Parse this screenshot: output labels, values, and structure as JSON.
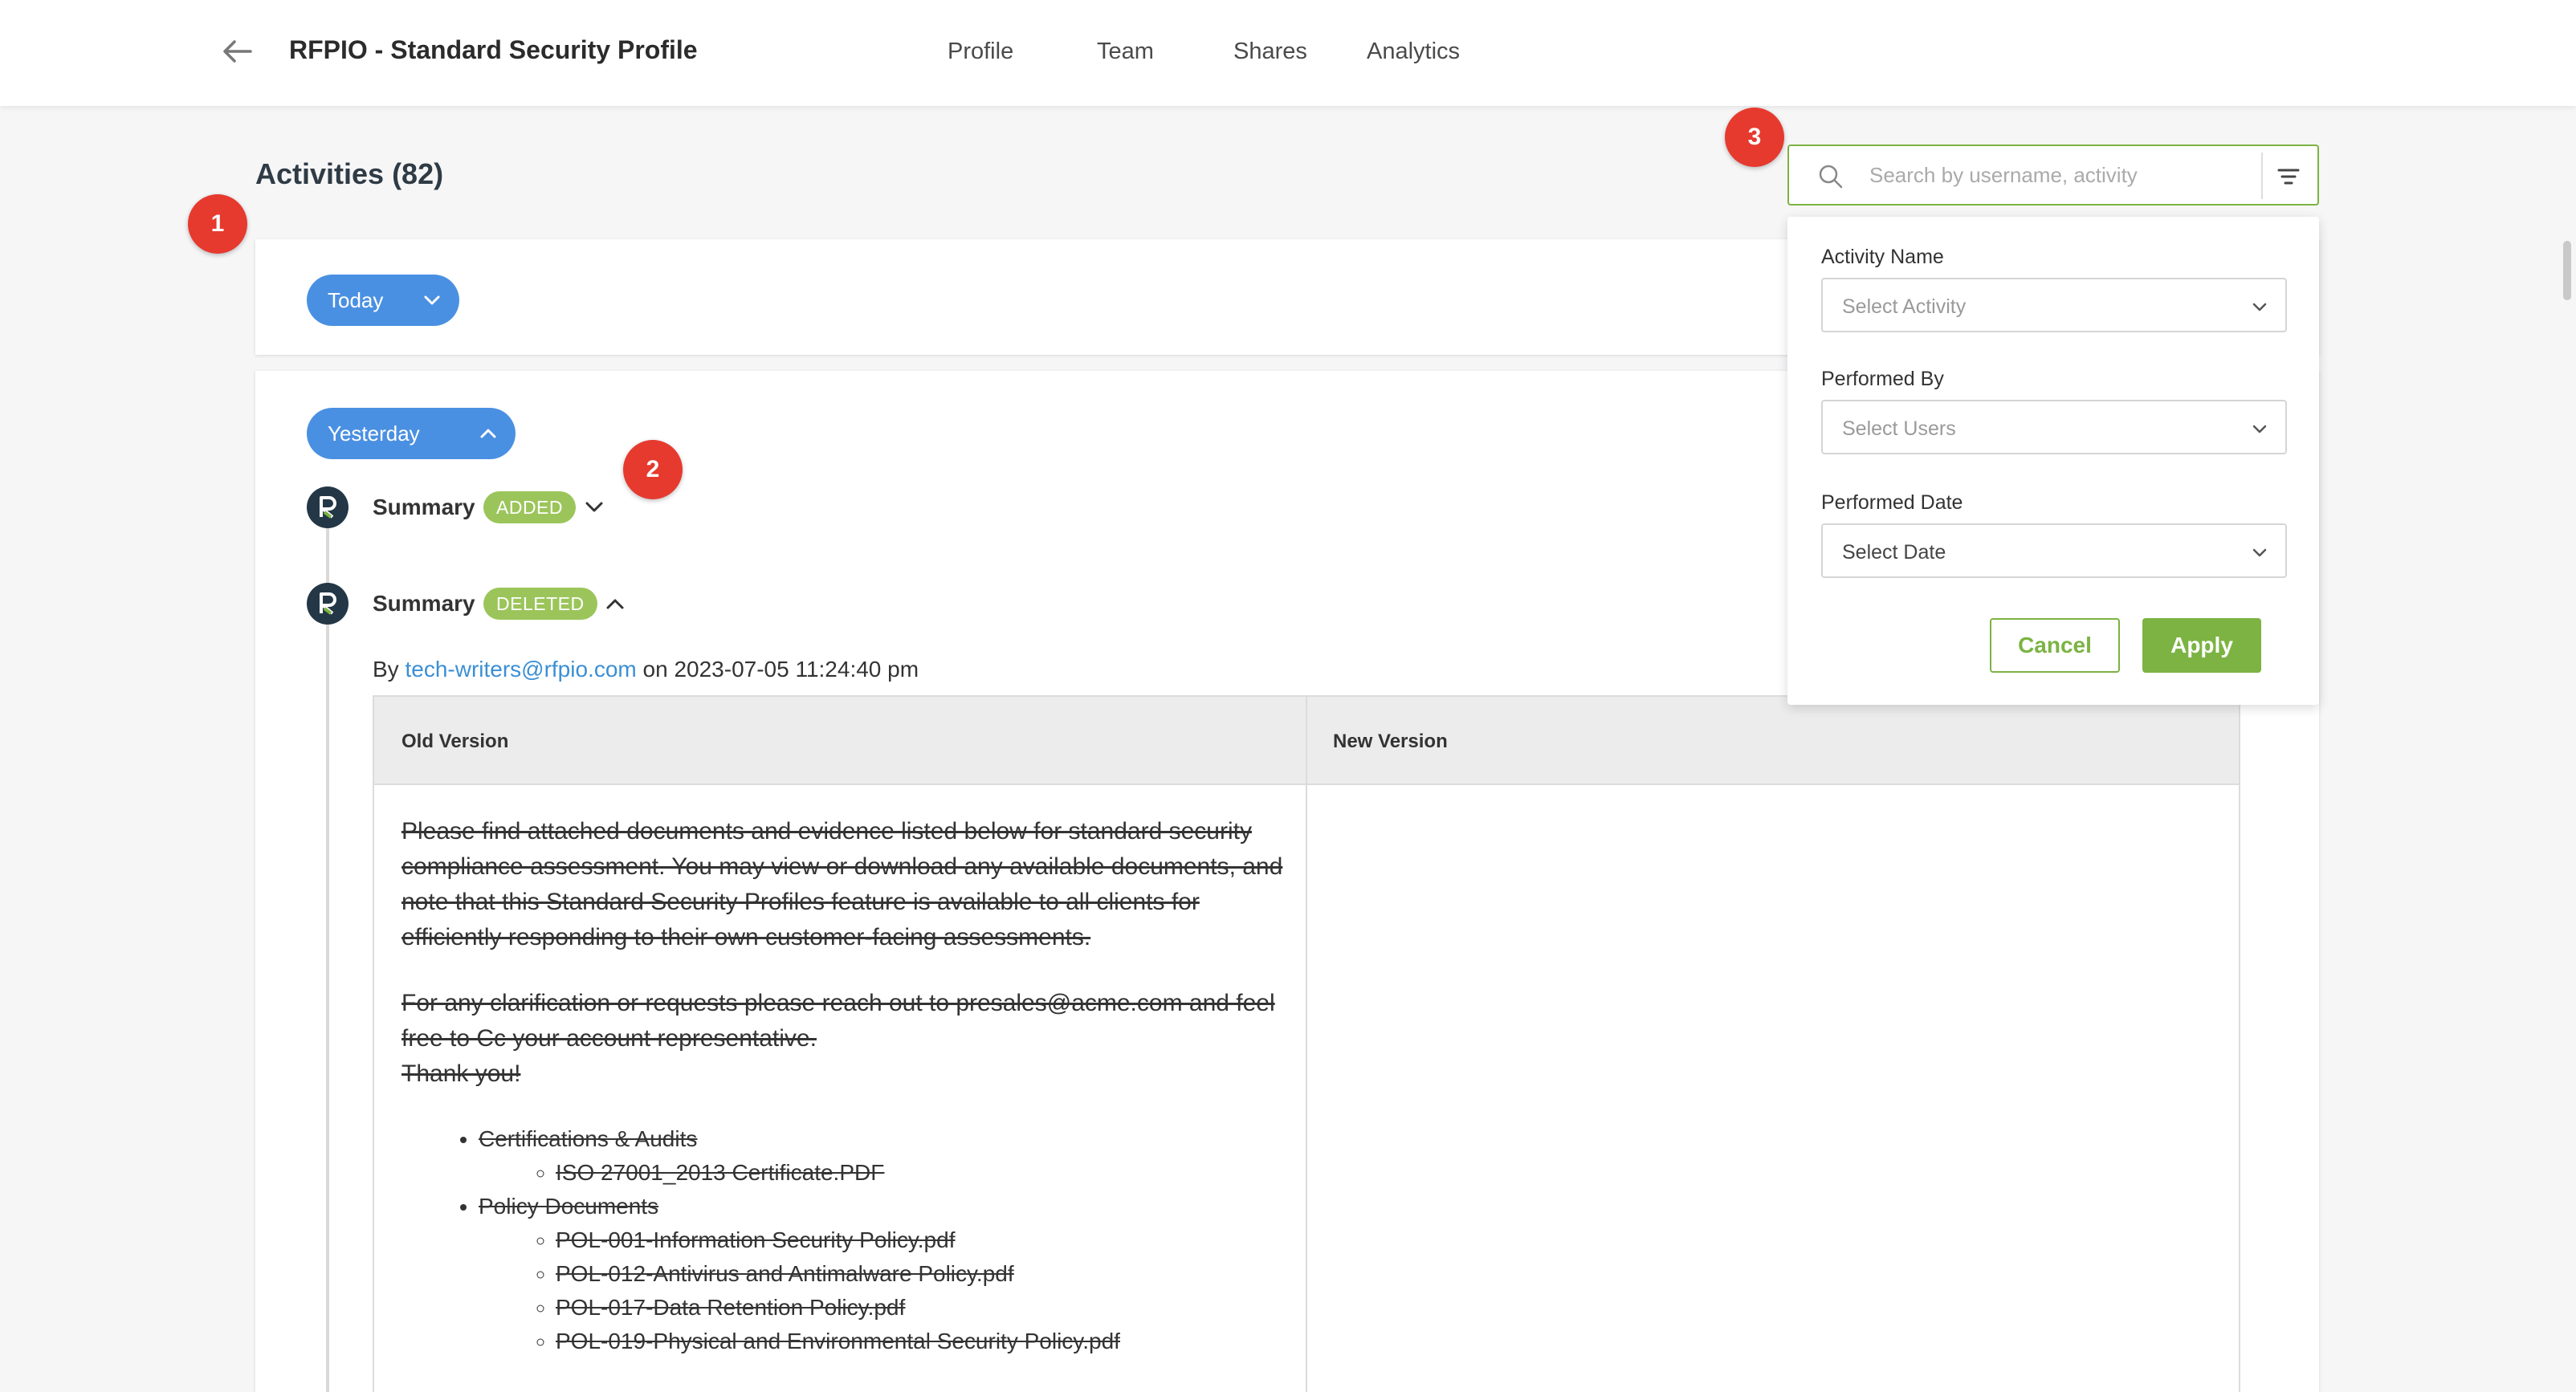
{
  "header": {
    "title": "RFPIO - Standard Security Profile",
    "tabs": [
      {
        "label": "Profile"
      },
      {
        "label": "Team"
      },
      {
        "label": "Shares"
      },
      {
        "label": "Analytics"
      }
    ]
  },
  "activities": {
    "title": "Activities (82)"
  },
  "markers": [
    "1",
    "2",
    "3"
  ],
  "groups": {
    "today": {
      "label": "Today"
    },
    "yesterday": {
      "label": "Yesterday"
    }
  },
  "entries": [
    {
      "label": "Summary",
      "status": "ADDED"
    },
    {
      "label": "Summary",
      "status": "DELETED"
    }
  ],
  "detail": {
    "by_prefix": "By",
    "user": "tech-writers@rfpio.com",
    "on_prefix": "on",
    "timestamp": "2023-07-05 11:24:40 pm",
    "old_header": "Old Version",
    "new_header": "New Version",
    "paragraph1": "Please find attached documents and evidence listed below for standard security compliance assessment. You may view or download any available documents, and note that this Standard Security Profiles feature is available to all clients for efficiently responding to their own customer-facing assessments.",
    "paragraph2": "For any clarification or requests please reach out to presales@acme.com and feel free to Cc your account representative.",
    "paragraph3": "Thank you!",
    "list": [
      {
        "title": "Certifications & Audits",
        "items": [
          "ISO 27001_2013 Certificate.PDF"
        ]
      },
      {
        "title": "Policy Documents",
        "items": [
          "POL-001-Information Security Policy.pdf",
          "POL-012-Antivirus and Antimalware Policy.pdf",
          "POL-017-Data Retention Policy.pdf",
          "POL-019-Physical and Environmental Security Policy.pdf"
        ]
      }
    ]
  },
  "search": {
    "placeholder": "Search by username, activity"
  },
  "filter": {
    "activity_label": "Activity Name",
    "activity_value": "Select Activity",
    "performed_by_label": "Performed By",
    "performed_by_value": "Select Users",
    "date_label": "Performed Date",
    "date_value": "Select Date",
    "cancel": "Cancel",
    "apply": "Apply"
  },
  "colors": {
    "accent_green": "#7cb342",
    "pill_blue": "#4a90e2",
    "badge_green": "#9bc55a",
    "marker_red": "#e63a2e"
  }
}
